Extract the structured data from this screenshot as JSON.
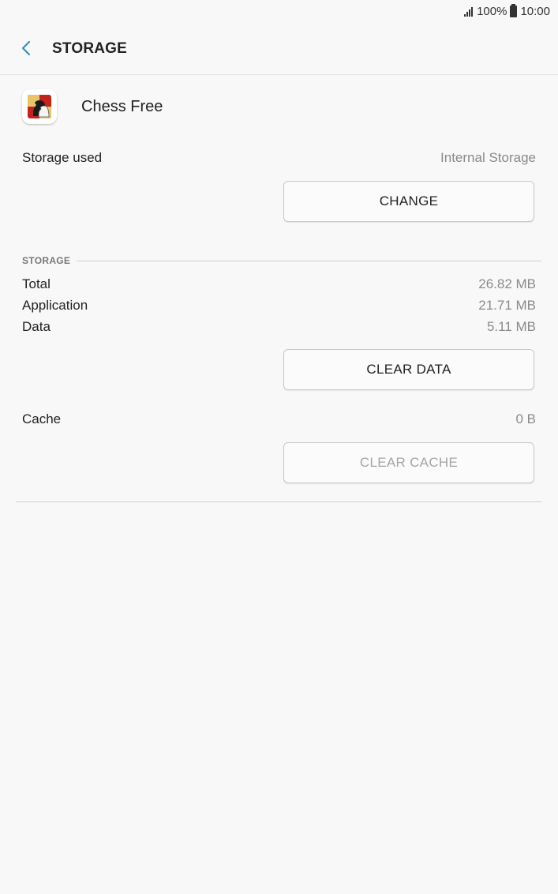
{
  "status_bar": {
    "battery": "100%",
    "time": "10:00",
    "icons": [
      "signal-icon",
      "battery-icon"
    ]
  },
  "header": {
    "title": "STORAGE",
    "back_icon": "back-arrow-icon"
  },
  "app": {
    "name": "Chess Free",
    "icon": "chess-knight-icon"
  },
  "storage_used": {
    "label": "Storage used",
    "value": "Internal Storage",
    "button": "CHANGE"
  },
  "storage_section": {
    "header": "STORAGE",
    "rows": [
      {
        "label": "Total",
        "value": "26.82 MB"
      },
      {
        "label": "Application",
        "value": "21.71 MB"
      },
      {
        "label": "Data",
        "value": "5.11 MB"
      }
    ],
    "clear_data_button": "CLEAR DATA"
  },
  "cache": {
    "label": "Cache",
    "value": "0 B",
    "button": "CLEAR CACHE",
    "button_enabled": false
  },
  "colors": {
    "accent": "#3a8fb7",
    "background": "#f8f8f8",
    "secondary_text": "#8a8a8a",
    "disabled_text": "#a5a5a5"
  }
}
